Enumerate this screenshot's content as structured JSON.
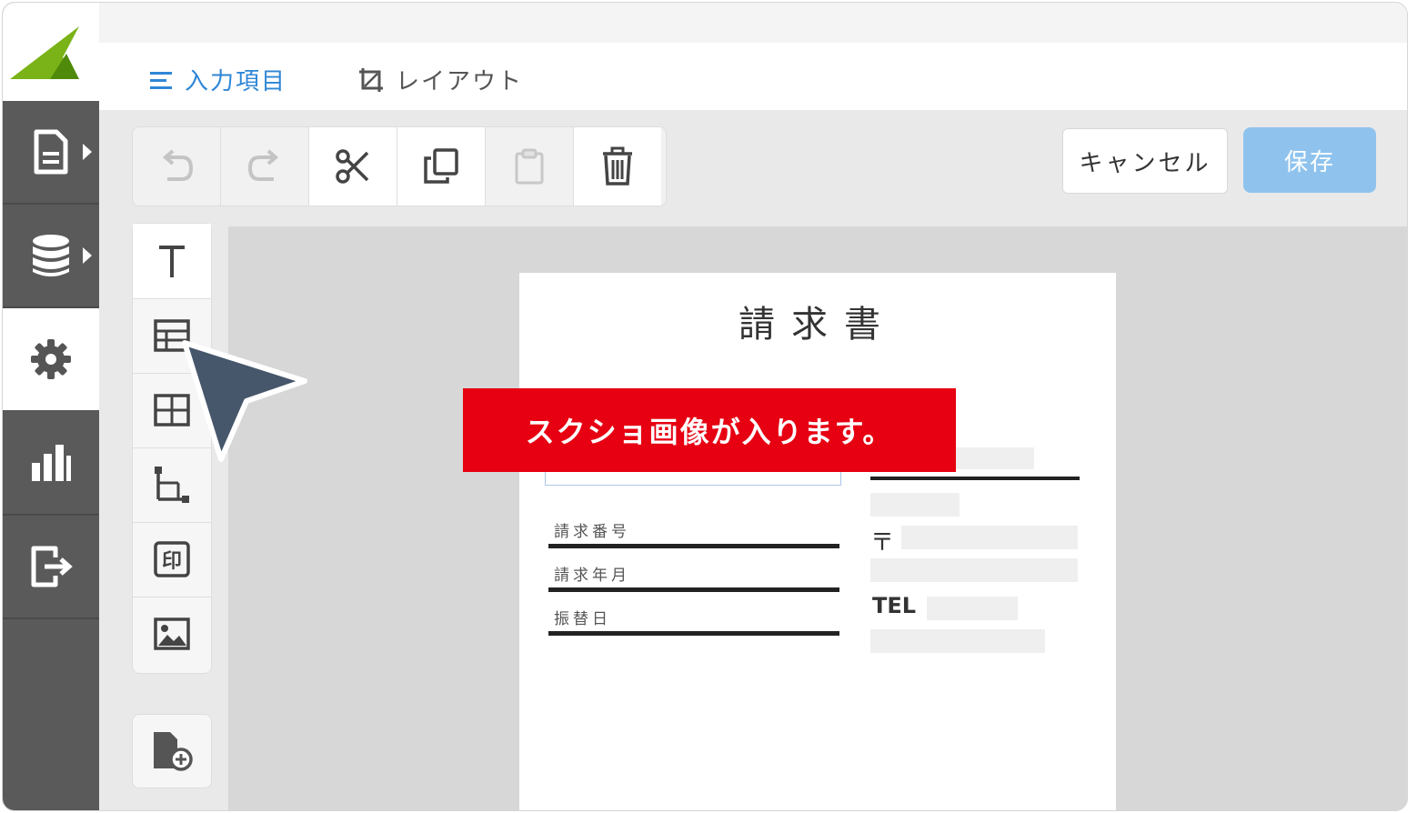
{
  "tabs": [
    {
      "label": "入力項目",
      "icon": "list-icon",
      "active": true
    },
    {
      "label": "レイアウト",
      "icon": "layout-crop-icon",
      "active": false
    }
  ],
  "sidebar": {
    "items": [
      {
        "icon": "document-icon",
        "has_arrow": true
      },
      {
        "icon": "database-icon",
        "has_arrow": true
      },
      {
        "icon": "gear-icon",
        "active": true
      },
      {
        "icon": "bar-chart-icon"
      },
      {
        "icon": "export-icon"
      }
    ]
  },
  "toolbar": {
    "buttons": [
      "undo-icon",
      "redo-icon",
      "cut-icon",
      "copy-icon",
      "paste-icon",
      "trash-icon"
    ],
    "cancel_label": "キャンセル",
    "save_label": "保存"
  },
  "palette": {
    "items": [
      "text-icon",
      "field-table-icon",
      "grid-table-icon",
      "line-tool-icon",
      "stamp-icon",
      "image-icon"
    ],
    "add_page_icon": "add-page-icon"
  },
  "document": {
    "title": "請求書",
    "fields": [
      "請求番号",
      "請求年月",
      "振替日"
    ],
    "postal_mark": "〒",
    "tel_label": "TEL"
  },
  "banner": {
    "text": "スクショ画像が入ります。"
  },
  "colors": {
    "sidebar": "#5a5a5a",
    "accent": "#2f86d6",
    "save_button": "#8fc3ee",
    "banner": "#e60012",
    "logo": "#7ab317"
  }
}
